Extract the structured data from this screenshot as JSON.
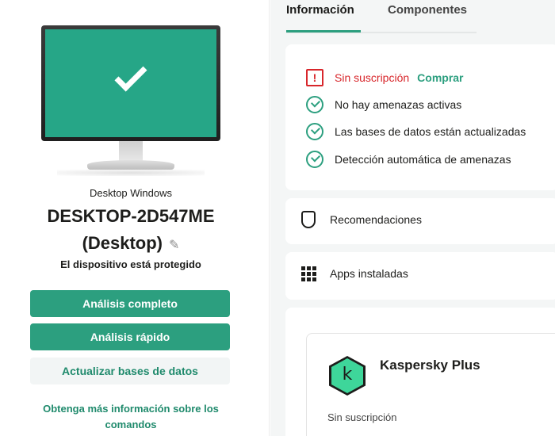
{
  "device": {
    "type_label": "Desktop Windows",
    "name_line1": "DESKTOP-2D547ME",
    "name_line2": "(Desktop)",
    "status": "El dispositivo está protegido"
  },
  "actions": {
    "full_scan": "Análisis completo",
    "quick_scan": "Análisis rápido",
    "update_db": "Actualizar bases de datos",
    "more_info": "Obtenga más información sobre los comandos"
  },
  "tabs": [
    {
      "label": "Información",
      "active": true
    },
    {
      "label": "Componentes",
      "active": false
    }
  ],
  "status_list": {
    "subscription": "Sin suscripción",
    "buy": "Comprar",
    "alert_symbol": "!",
    "items": [
      "No hay amenazas activas",
      "Las bases de datos están actualizadas",
      "Detección automática de amenazas"
    ]
  },
  "sections": {
    "recommendations": "Recomendaciones",
    "installed_apps": "Apps instaladas"
  },
  "product": {
    "logo_letter": "k",
    "name": "Kaspersky Plus",
    "subscription": "Sin suscripción"
  },
  "colors": {
    "accent": "#2c9f7f",
    "alert": "#d8262b",
    "screen": "#26a687",
    "panel_bg": "#f4f6f6"
  },
  "icons": [
    "check-icon",
    "edit-pencil-icon",
    "alert-icon",
    "check-circle-icon",
    "shield-icon",
    "apps-grid-icon",
    "kaspersky-logo-icon"
  ]
}
